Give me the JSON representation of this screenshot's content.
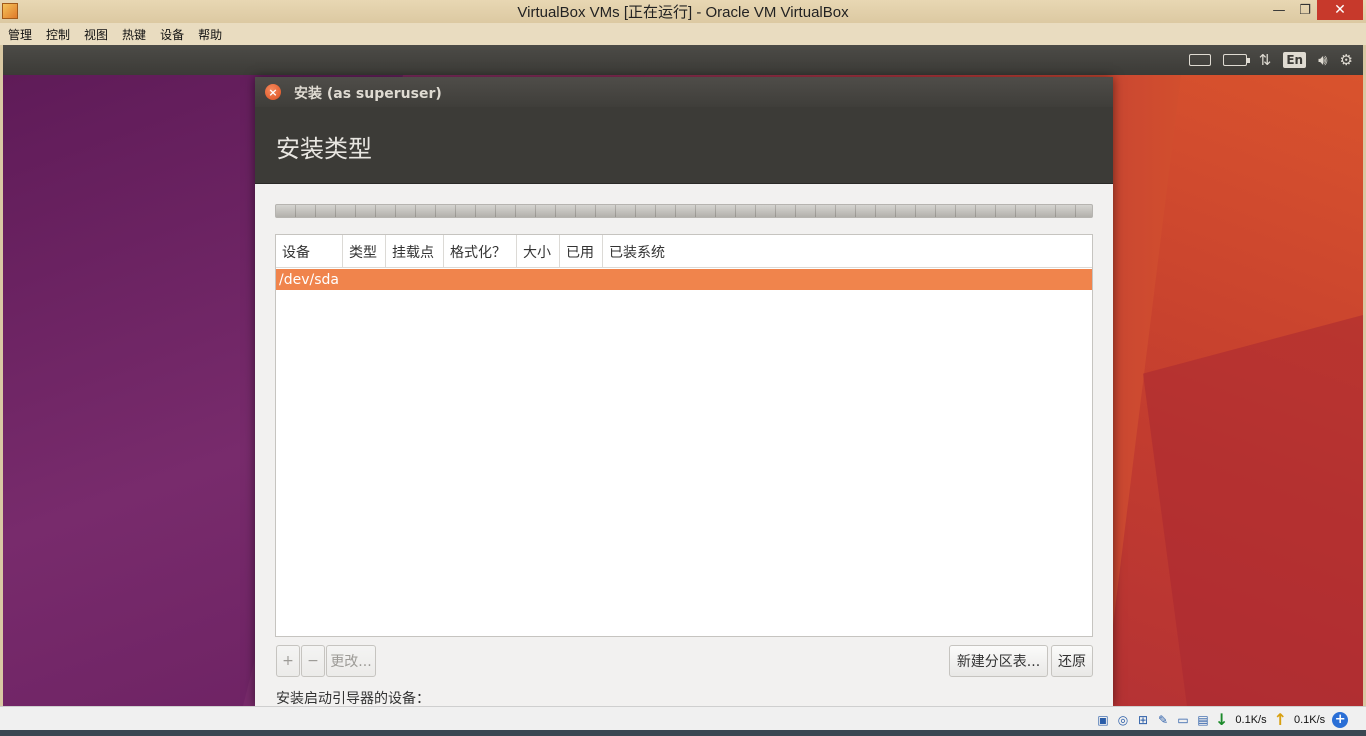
{
  "host_window": {
    "title": "VirtualBox VMs [正在运行] - Oracle VM VirtualBox",
    "minimize_glyph": "—",
    "maximize_glyph": "❐",
    "close_glyph": "✕"
  },
  "host_menu": {
    "items": [
      "管理",
      "控制",
      "视图",
      "热键",
      "设备",
      "帮助"
    ]
  },
  "ubuntu_panel": {
    "language": "En",
    "icons": [
      "keyboard-icon",
      "battery-icon",
      "network-arrows-icon",
      "language-indicator",
      "volume-icon",
      "settings-gear-icon"
    ]
  },
  "dialog": {
    "title": "安装 (as superuser)",
    "close_glyph": "×",
    "heading": "安装类型",
    "table": {
      "columns": [
        "设备",
        "类型",
        "挂载点",
        "格式化？",
        "大小",
        "已用",
        "已装系统"
      ],
      "rows": [
        {
          "device": "/dev/sda",
          "selected": true
        }
      ]
    },
    "buttons": {
      "add": "+",
      "remove": "−",
      "change": "更改...",
      "new_partition_table": "新建分区表...",
      "revert": "还原"
    },
    "boot_loader_label": "安装启动引导器的设备："
  },
  "host_status": {
    "download_speed": "0.1K/s",
    "upload_speed": "0.1K/s"
  },
  "colors": {
    "selection_orange": "#f0844c",
    "panel_dark": "#3c3b37",
    "close_orange": "#dd4f1f"
  }
}
